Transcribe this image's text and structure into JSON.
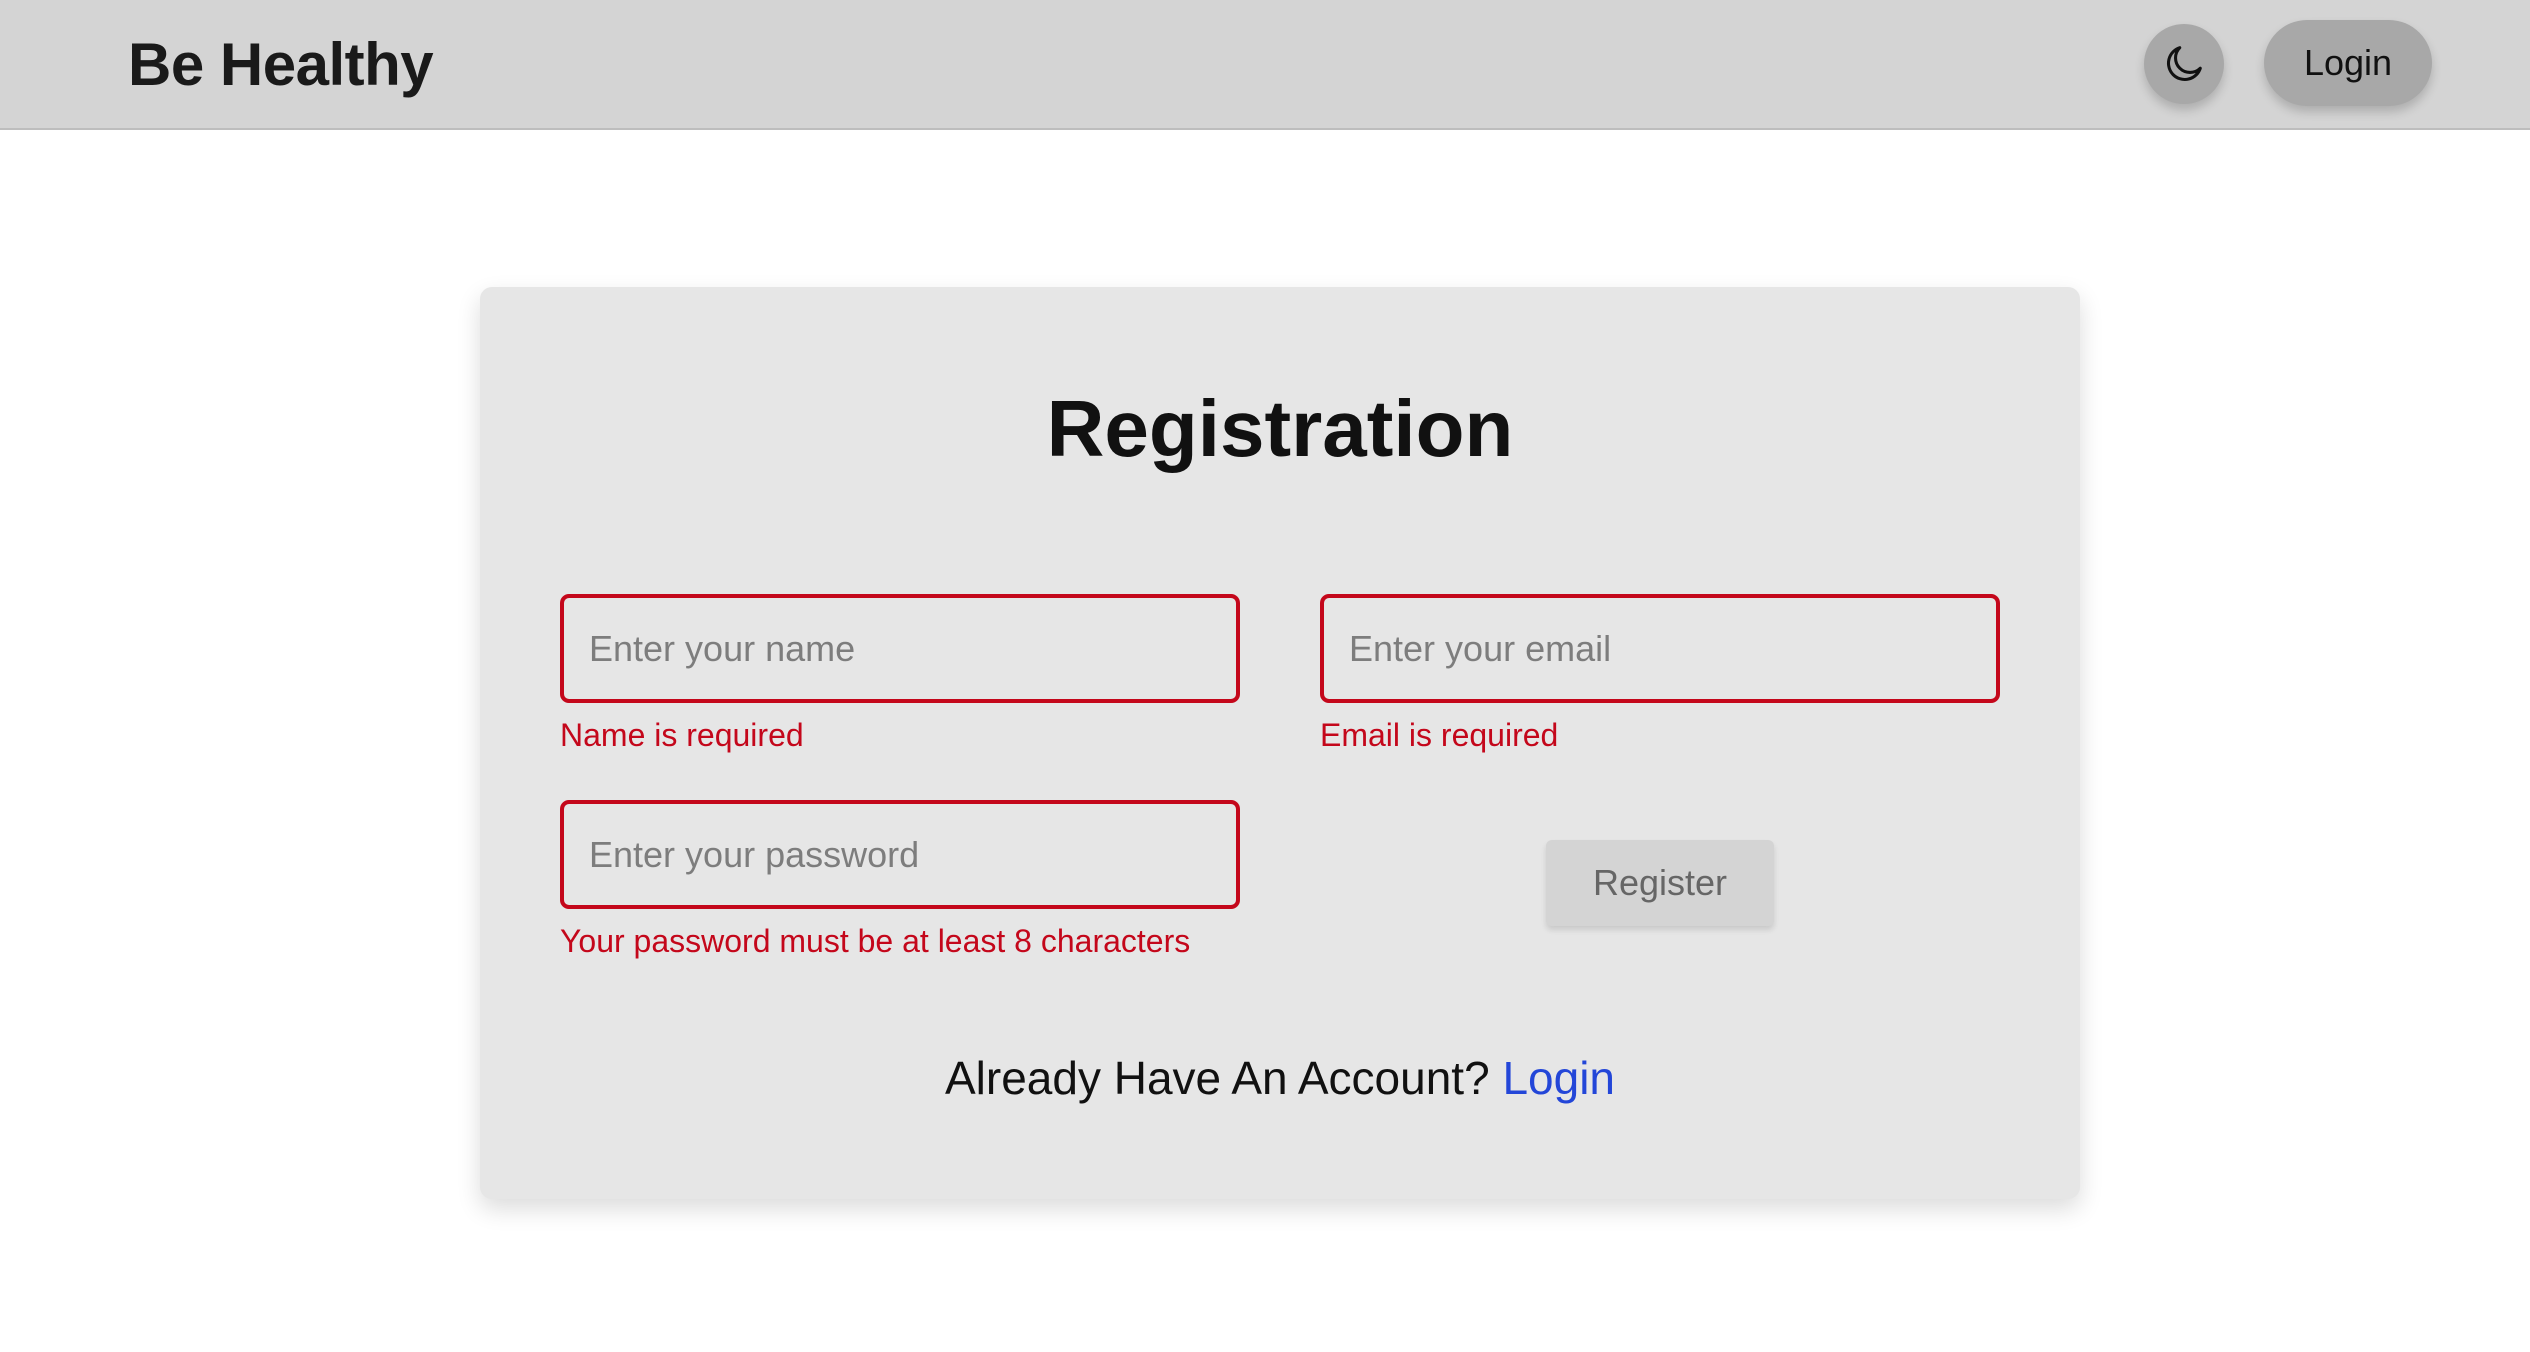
{
  "navbar": {
    "brand": "Be Healthy",
    "theme_toggle_icon": "moon-icon",
    "login_label": "Login"
  },
  "form": {
    "title": "Registration",
    "name": {
      "placeholder": "Enter your name",
      "value": "",
      "error": "Name is required"
    },
    "email": {
      "placeholder": "Enter your email",
      "value": "",
      "error": "Email is required"
    },
    "password": {
      "placeholder": "Enter your password",
      "value": "",
      "error": "Your password must be at least 8 characters"
    },
    "register_label": "Register",
    "footer_text": "Already Have An Account?",
    "footer_link": "Login"
  },
  "colors": {
    "navbar_bg": "#d4d4d4",
    "card_bg": "#e6e6e6",
    "error": "#c4071b",
    "link": "#2346d8",
    "button_bg": "#a8a8a8"
  }
}
